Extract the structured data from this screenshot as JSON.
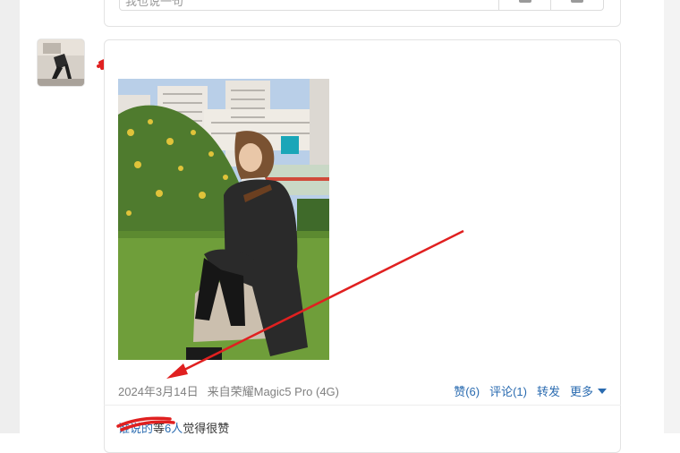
{
  "previous_post": {
    "comment_placeholder": "我也说一句"
  },
  "post": {
    "date": "2024年3月14日",
    "source": "来自荣耀Magic5 Pro (4G)",
    "actions": {
      "like": "赞(6)",
      "comment": "评论(1)",
      "share": "转发",
      "more": "更多"
    },
    "likes": {
      "liker_name": "谁说的",
      "middle": "等",
      "count": "6人",
      "suffix": "觉得很赞"
    }
  },
  "colors": {
    "link": "#2a6bb0",
    "annotation_red": "#e02020"
  }
}
